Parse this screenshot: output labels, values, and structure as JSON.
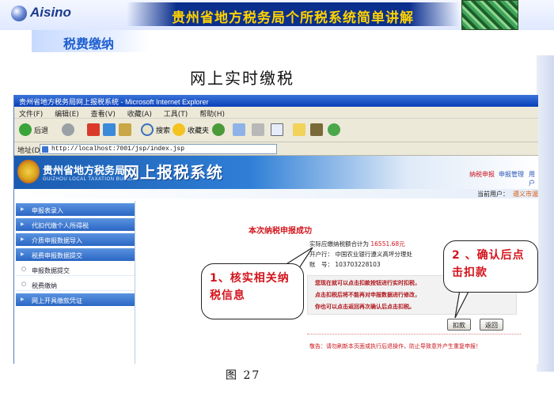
{
  "slide": {
    "logo": "Aisino",
    "title": "贵州省地方税务局个所税系统简单讲解",
    "section": "税费缴纳",
    "subtitle": "网上实时缴税",
    "caption": "图 27"
  },
  "browser": {
    "window_title": "贵州省地方税务局网上报税系统 - Microsoft Internet Explorer",
    "menu": [
      "文件(F)",
      "编辑(E)",
      "查看(V)",
      "收藏(A)",
      "工具(T)",
      "帮助(H)"
    ],
    "toolbar": {
      "back": "后退",
      "search": "搜索",
      "favorites": "收藏夹"
    },
    "address_label": "地址(D)",
    "address_value": "http://localhost:7001/jsp/index.jsp"
  },
  "site": {
    "banner_cn": "贵州省地方税务局",
    "banner_en": "GUIZHOU LOCAL TAXATION BUREAU",
    "system_name": "网上报税系统",
    "nav": [
      "纳税申报",
      "申报管理",
      "用户"
    ],
    "current_user_label": "当前用户：",
    "current_user_value": "遵义市湄"
  },
  "sidebar": {
    "items": [
      {
        "label": "申报表录入",
        "kind": "menu"
      },
      {
        "label": "代扣代缴个人所得税",
        "kind": "menu"
      },
      {
        "label": "介质申报数据导入",
        "kind": "menu"
      },
      {
        "label": "税费申报数据提交",
        "kind": "menu"
      },
      {
        "label": "申报数据提交",
        "kind": "sub"
      },
      {
        "label": "税费缴纳",
        "kind": "sub"
      },
      {
        "label": "网上开具缴款凭证",
        "kind": "menu"
      }
    ]
  },
  "result": {
    "title": "本次纳税申报成功",
    "amount_label": "实际应缴纳税额合计为",
    "amount_value": "16551.68元",
    "bank_label": "开户行：",
    "bank_value": "中国农业银行遵义高坪分理处",
    "account_label": "账　号：",
    "account_value": "103703228103",
    "notice": [
      "您现在就可以点击扣款按钮进行实时扣税，",
      "点击扣税后将不能再对申报数据进行修改，",
      "你也可以点击返回再次确认后点击扣税。"
    ],
    "buttons": {
      "deduct": "扣款",
      "back": "返回"
    },
    "warning": "敬告：请勿刷新本页面或执行后退操作，防止导致意外产生重复申报！"
  },
  "callouts": {
    "left": "1、核实相关纳税信息",
    "right": "2 、确认后点击扣款"
  },
  "colors": {
    "slide_title_band": "#0b2f8c",
    "slide_title_text": "#ffd200",
    "accent_red": "#d4141c",
    "menu_blue": "#2b66c4"
  }
}
